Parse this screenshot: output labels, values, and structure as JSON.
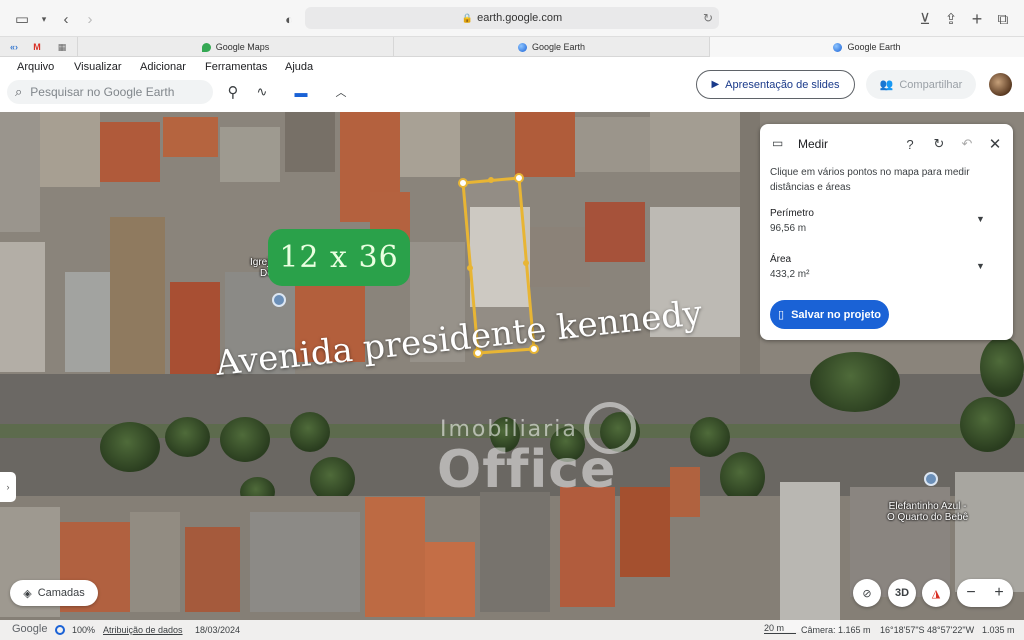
{
  "browser": {
    "url": "earth.google.com",
    "tabs": [
      {
        "title": "Google Maps",
        "icon": "maps-pin-icon"
      },
      {
        "title": "Google Earth",
        "icon": "earth-globe-icon"
      },
      {
        "title": "Google Earth",
        "icon": "earth-globe-icon",
        "active": true
      }
    ],
    "pinned": [
      {
        "icon": "pinned-site-icon",
        "glyph": "«›"
      },
      {
        "icon": "gmail-icon",
        "glyph": "M"
      },
      {
        "icon": "pinned-photo-icon",
        "glyph": "▦"
      }
    ]
  },
  "menu": {
    "items": [
      "Arquivo",
      "Visualizar",
      "Adicionar",
      "Ferramentas",
      "Ajuda"
    ]
  },
  "search": {
    "placeholder": "Pesquisar no Google Earth"
  },
  "header": {
    "slides_label": "Apresentação de slides",
    "share_label": "Compartilhar"
  },
  "measure": {
    "title": "Medir",
    "description": "Clique em vários pontos no mapa para medir distâncias e áreas",
    "perimeter_label": "Perímetro",
    "perimeter_value": "96,56 m",
    "area_label": "Área",
    "area_value": "433,2 m²",
    "save_label": "Salvar no projeto"
  },
  "map": {
    "badge": "12 x 36",
    "street": "Avenida presidente kennedy",
    "watermark_top": "Imobiliaria",
    "watermark_main": "Office",
    "places": [
      {
        "line1": "Igreja Cri",
        "line2": "Do M"
      },
      {
        "line1": "Elefantinho Azul -",
        "line2": "O Quarto do Bebê"
      }
    ]
  },
  "controls": {
    "layers_label": "Camadas",
    "three_d_label": "3D",
    "zoom_out": "−",
    "zoom_in": "+"
  },
  "status": {
    "logo": "Google",
    "zoom": "100%",
    "attribution": "Atribuição de dados",
    "date": "18/03/2024",
    "scale": "20 m",
    "camera": "Câmera: 1.165 m",
    "coords": "16°18'57\"S 48°57'22\"W",
    "altitude": "1.035 m"
  },
  "colors": {
    "accent": "#1a62d6",
    "badge": "#2aa14a",
    "measure_line": "#e8b534"
  }
}
